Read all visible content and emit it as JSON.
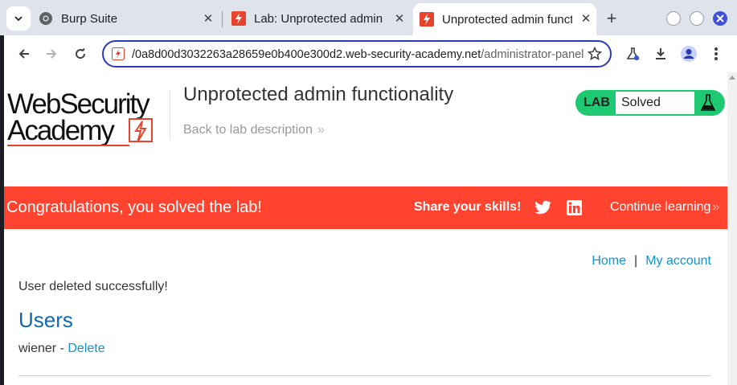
{
  "browser": {
    "tabs": [
      {
        "title": "Burp Suite",
        "active": false
      },
      {
        "title": "Lab: Unprotected admin functionality",
        "active": false
      },
      {
        "title": "Unprotected admin functionality",
        "active": true
      }
    ],
    "url": {
      "host": "/0a8d00d3032263a28659e0b400e300d2.web-security-academy.net",
      "path": "/administrator-panel"
    }
  },
  "header": {
    "logo_line1": "WebSecurity",
    "logo_line2": "Academy",
    "lab_title": "Unprotected admin functionality",
    "back_link": "Back to lab description",
    "lab_badge": "LAB",
    "lab_status": "Solved"
  },
  "banner": {
    "congrats": "Congratulations, you solved the lab!",
    "share": "Share your skills!",
    "continue": "Continue learning"
  },
  "nav": {
    "home": "Home",
    "separator": "|",
    "account": "My account"
  },
  "main": {
    "message": "User deleted successfully!",
    "users_heading": "Users",
    "users": [
      {
        "name": "wiener",
        "separator": " - ",
        "action": "Delete"
      }
    ]
  },
  "colors": {
    "banner": "#ff432f",
    "lab_green": "#1ec972",
    "link": "#0e94d2",
    "heading": "#0e6ab4"
  }
}
